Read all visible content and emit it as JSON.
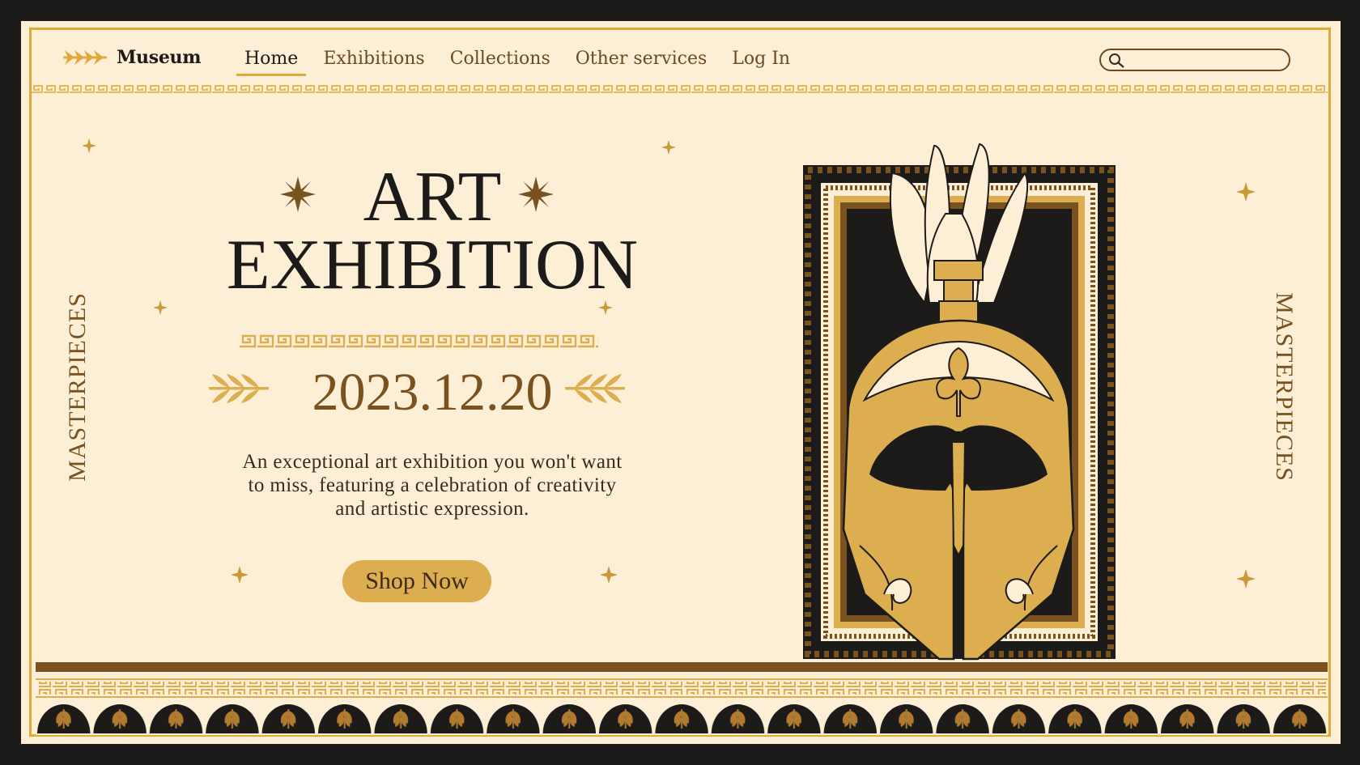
{
  "header": {
    "brand": "Museum",
    "nav": [
      "Home",
      "Exhibitions",
      "Collections",
      "Other services",
      "Log In"
    ],
    "active_nav": "Home",
    "search_placeholder": ""
  },
  "hero": {
    "title_line1": "ART",
    "title_line2": "EXHIBITION",
    "date": "2023.12.20",
    "description_line1": "An exceptional art exhibition you won't want",
    "description_line2": "to miss, featuring a celebration of creativity",
    "description_line3": "and artistic expression.",
    "cta": "Shop Now"
  },
  "side_text": {
    "left": "MASTERPIECES",
    "right": "MASTERPIECES"
  },
  "icons": {
    "logo": "laurel-arrow-icon",
    "search": "search-icon",
    "stars": "star-icon",
    "laurels": "laurel-branch-icon",
    "artwork": "corinthian-helmet"
  },
  "colors": {
    "background": "#fcefd6",
    "frame": "#1d1b19",
    "gold": "#dcae4f",
    "brown": "#7a5220",
    "text_dark": "#1d1b19"
  }
}
